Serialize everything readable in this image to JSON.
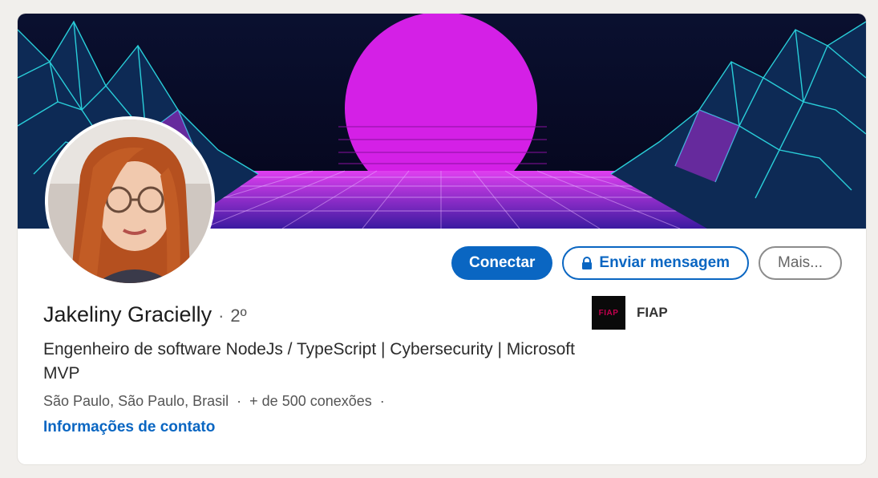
{
  "profile": {
    "name": "Jakeliny Gracielly",
    "separator": "·",
    "degree": "2º",
    "headline": "Engenheiro de software NodeJs / TypeScript | Cybersecurity | Microsoft MVP",
    "location": "São Paulo, São Paulo, Brasil",
    "meta_separator": "·",
    "connections": "+ de 500 conexões",
    "meta_trailing": "·",
    "contact_link": "Informações de contato"
  },
  "actions": {
    "connect_label": "Conectar",
    "message_label": "Enviar mensagem",
    "more_label": "Mais..."
  },
  "company": {
    "name": "FIAP",
    "logo_text": "FIAP"
  },
  "colors": {
    "primary": "#0a66c2",
    "banner_sky": "#0b0b2e",
    "banner_sun": "#d21fe8",
    "banner_grid": "#2de0e8"
  },
  "icons": {
    "message_button": "lock-icon"
  }
}
